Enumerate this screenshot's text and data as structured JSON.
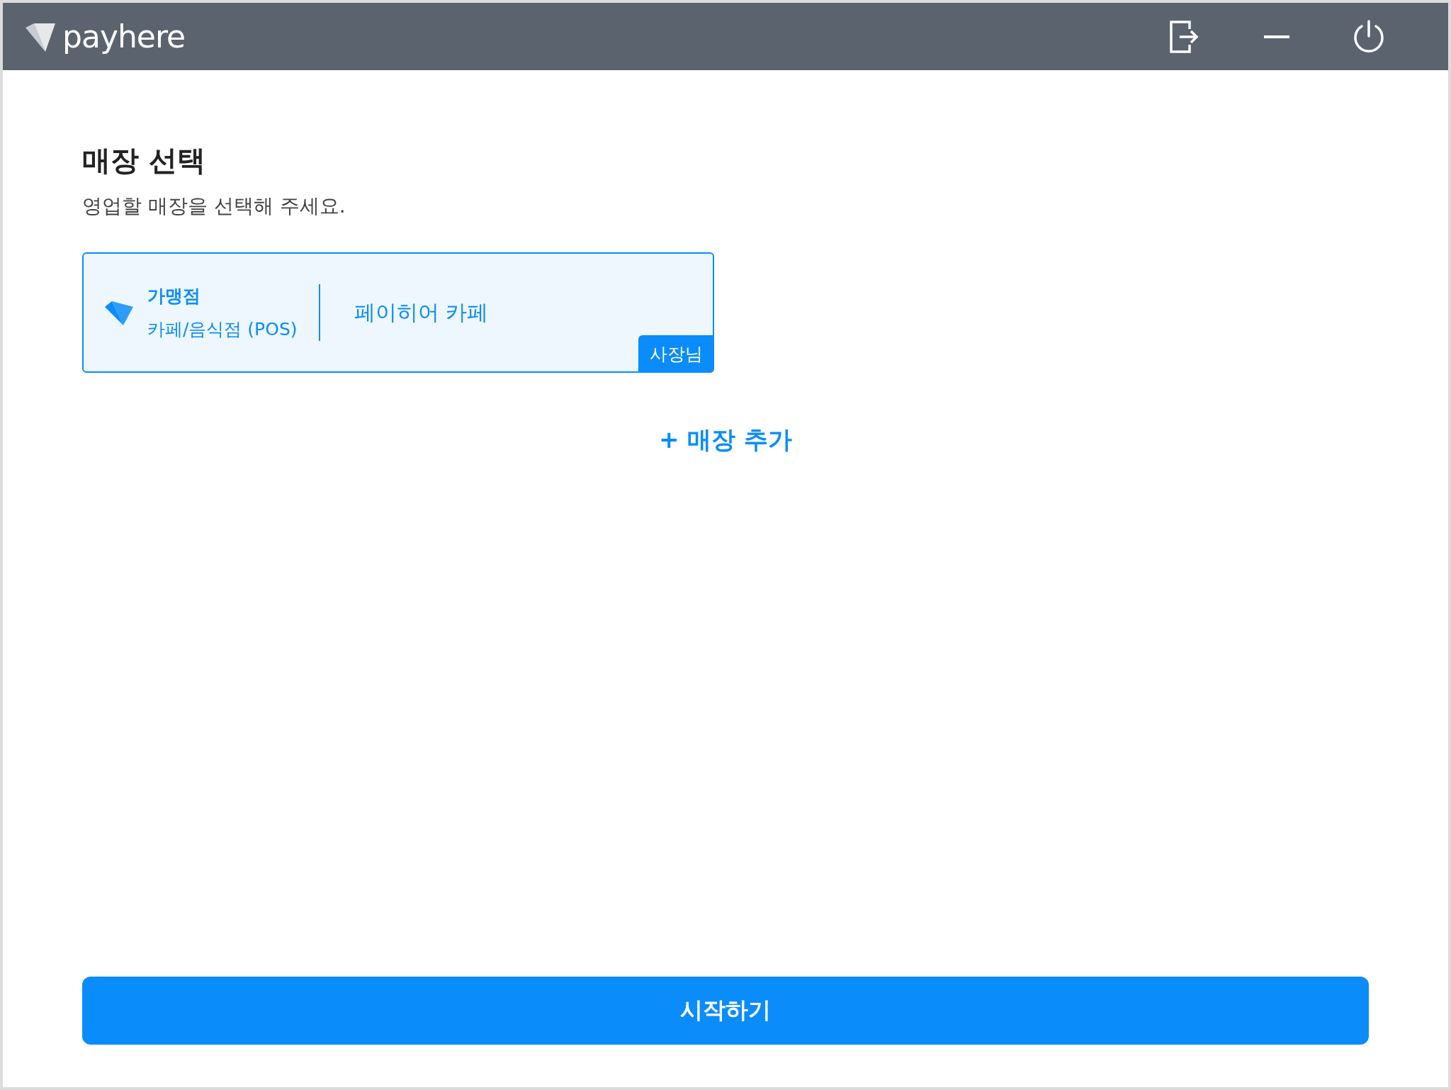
{
  "header": {
    "logo": "payhere"
  },
  "page": {
    "title": "매장 선택",
    "subtitle": "영업할 매장을 선택해 주세요."
  },
  "stores": [
    {
      "type": "가맹점",
      "category": "카페/음식점 (POS)",
      "name": "페이히어 카페",
      "role": "사장님",
      "selected": true
    }
  ],
  "add_store": "+ 매장 추가",
  "start_button": "시작하기"
}
